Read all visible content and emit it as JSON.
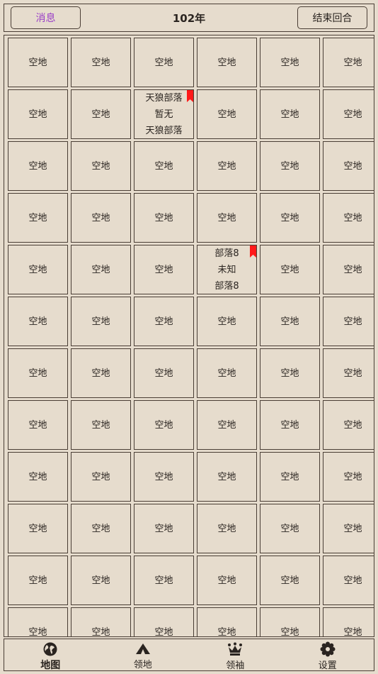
{
  "header": {
    "messages_label": "消息",
    "year_title": "102年",
    "end_turn_label": "结束回合"
  },
  "map": {
    "empty_label": "空地",
    "rows": 12,
    "cols": 6,
    "special_cells": [
      {
        "row": 1,
        "col": 2,
        "lines": [
          "天狼部落",
          "暂无",
          "天狼部落"
        ],
        "flag": true
      },
      {
        "row": 4,
        "col": 3,
        "lines": [
          "部落8",
          "未知",
          "部落8"
        ],
        "flag": true
      }
    ],
    "flag_color": "#ff1a1a"
  },
  "nav": {
    "items": [
      {
        "label": "地图",
        "icon": "globe-icon",
        "active": true
      },
      {
        "label": "领地",
        "icon": "tent-icon",
        "active": false
      },
      {
        "label": "领袖",
        "icon": "crown-icon",
        "active": false
      },
      {
        "label": "设置",
        "icon": "gear-icon",
        "active": false
      }
    ]
  }
}
